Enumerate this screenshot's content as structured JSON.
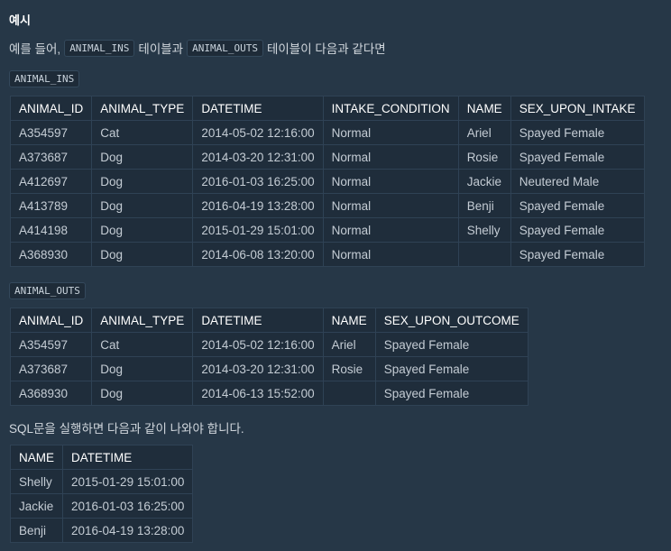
{
  "heading": "예시",
  "intro": {
    "prefix": "예를 들어,",
    "code1": "ANIMAL_INS",
    "middle": "테이블과",
    "code2": "ANIMAL_OUTS",
    "suffix": "테이블이 다음과 같다면"
  },
  "ins_table": {
    "label": "ANIMAL_INS",
    "columns": [
      "ANIMAL_ID",
      "ANIMAL_TYPE",
      "DATETIME",
      "INTAKE_CONDITION",
      "NAME",
      "SEX_UPON_INTAKE"
    ],
    "rows": [
      [
        "A354597",
        "Cat",
        "2014-05-02 12:16:00",
        "Normal",
        "Ariel",
        "Spayed Female"
      ],
      [
        "A373687",
        "Dog",
        "2014-03-20 12:31:00",
        "Normal",
        "Rosie",
        "Spayed Female"
      ],
      [
        "A412697",
        "Dog",
        "2016-01-03 16:25:00",
        "Normal",
        "Jackie",
        "Neutered Male"
      ],
      [
        "A413789",
        "Dog",
        "2016-04-19 13:28:00",
        "Normal",
        "Benji",
        "Spayed Female"
      ],
      [
        "A414198",
        "Dog",
        "2015-01-29 15:01:00",
        "Normal",
        "Shelly",
        "Spayed Female"
      ],
      [
        "A368930",
        "Dog",
        "2014-06-08 13:20:00",
        "Normal",
        "",
        "Spayed Female"
      ]
    ]
  },
  "outs_table": {
    "label": "ANIMAL_OUTS",
    "columns": [
      "ANIMAL_ID",
      "ANIMAL_TYPE",
      "DATETIME",
      "NAME",
      "SEX_UPON_OUTCOME"
    ],
    "rows": [
      [
        "A354597",
        "Cat",
        "2014-05-02 12:16:00",
        "Ariel",
        "Spayed Female"
      ],
      [
        "A373687",
        "Dog",
        "2014-03-20 12:31:00",
        "Rosie",
        "Spayed Female"
      ],
      [
        "A368930",
        "Dog",
        "2014-06-13 15:52:00",
        "",
        "Spayed Female"
      ]
    ]
  },
  "outro": "SQL문을 실행하면 다음과 같이 나와야 합니다.",
  "result_table": {
    "columns": [
      "NAME",
      "DATETIME"
    ],
    "rows": [
      [
        "Shelly",
        "2015-01-29 15:01:00"
      ],
      [
        "Jackie",
        "2016-01-03 16:25:00"
      ],
      [
        "Benji",
        "2016-04-19 13:28:00"
      ]
    ]
  }
}
